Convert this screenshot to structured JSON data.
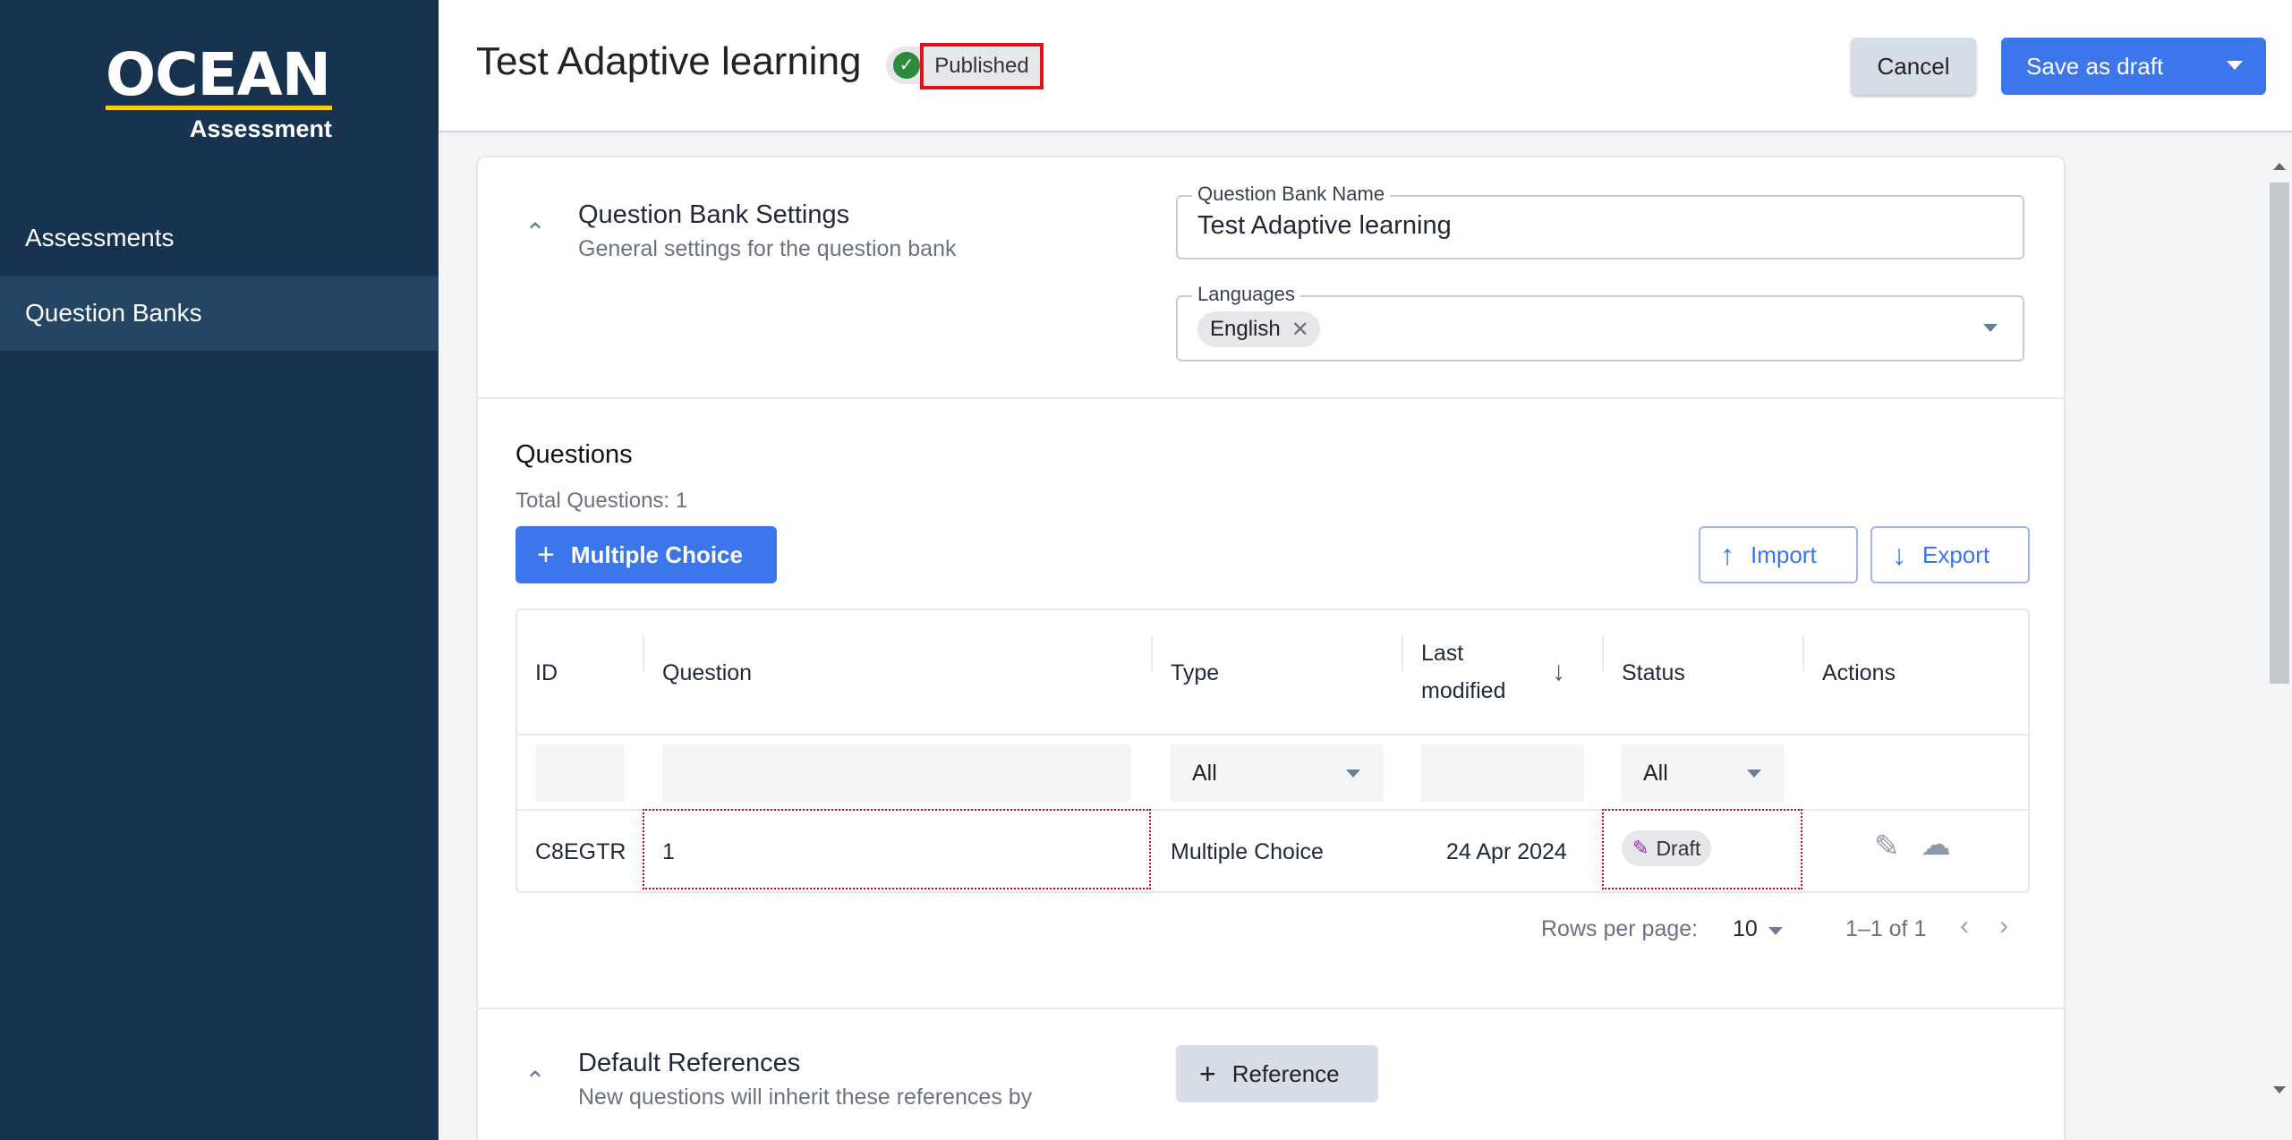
{
  "sidebar": {
    "logo": {
      "title": "OCEAN",
      "subtitle": "Assessment"
    },
    "items": [
      {
        "label": "Assessments"
      },
      {
        "label": "Question Banks"
      }
    ]
  },
  "header": {
    "title": "Test Adaptive learning",
    "status": "Published",
    "cancel_label": "Cancel",
    "save_label": "Save as draft"
  },
  "settings": {
    "title": "Question Bank Settings",
    "subtitle": "General settings for the question bank",
    "name_label": "Question Bank Name",
    "name_value": "Test Adaptive learning",
    "languages_label": "Languages",
    "languages": [
      "English"
    ]
  },
  "questions": {
    "title": "Questions",
    "total": "Total Questions: 1",
    "add_label": "Multiple Choice",
    "import_label": "Import",
    "export_label": "Export",
    "columns": {
      "id": "ID",
      "question": "Question",
      "type": "Type",
      "last_modified_1": "Last",
      "last_modified_2": "modified",
      "status": "Status",
      "actions": "Actions"
    },
    "filters": {
      "type": "All",
      "status": "All"
    },
    "rows": [
      {
        "id": "C8EGTR",
        "question": "1",
        "type": "Multiple Choice",
        "modified": "24 Apr 2024",
        "status": "Draft"
      }
    ],
    "pager": {
      "rows_label": "Rows per page:",
      "rows_value": "10",
      "range": "1–1 of 1"
    }
  },
  "references": {
    "title": "Default References",
    "subtitle": "New questions will inherit these references by",
    "add_label": "Reference"
  },
  "colors": {
    "sidebar": "#17334f",
    "accent": "#3b76ea",
    "published": "#2f8a3c",
    "highlight": "#e0131c"
  }
}
